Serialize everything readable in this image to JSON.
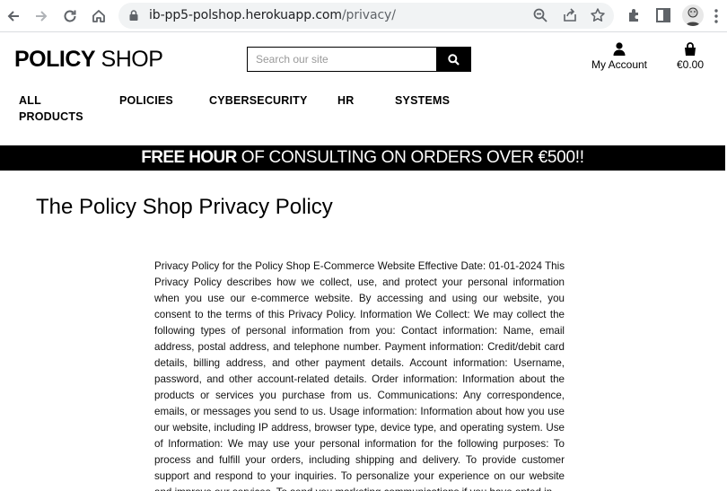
{
  "browser": {
    "url_domain": "ib-pp5-polshop.herokuapp.com",
    "url_path": "/privacy/"
  },
  "header": {
    "logo_bold": "POLICY",
    "logo_light": "SHOP",
    "search_placeholder": "Search our site",
    "account_label": "My Account",
    "cart_total": "€0.00"
  },
  "nav": {
    "items": [
      "ALL PRODUCTS",
      "POLICIES",
      "CYBERSECURITY",
      "HR",
      "SYSTEMS"
    ]
  },
  "banner": {
    "bold": "FREE HOUR",
    "rest": "OF CONSULTING ON ORDERS OVER €500!!"
  },
  "page": {
    "title": "The Policy Shop Privacy Policy",
    "body": "Privacy Policy for the Policy Shop E-Commerce Website Effective Date: 01-01-2024 This Privacy Policy describes how we collect, use, and protect your personal information when you use our e-commerce website. By accessing and using our website, you consent to the terms of this Privacy Policy. Information We Collect: We may collect the following types of personal information from you: Contact information: Name, email address, postal address, and telephone number. Payment information: Credit/debit card details, billing address, and other payment details. Account information: Username, password, and other account-related details. Order information: Information about the products or services you purchase from us. Communications: Any correspondence, emails, or messages you send to us. Usage information: Information about how you use our website, including IP address, browser type, device type, and operating system. Use of Information: We may use your personal information for the following purposes: To process and fulfill your orders, including shipping and delivery. To provide customer support and respond to your inquiries. To personalize your experience on our website and improve our services. To send you marketing communications if you have opted in"
  }
}
